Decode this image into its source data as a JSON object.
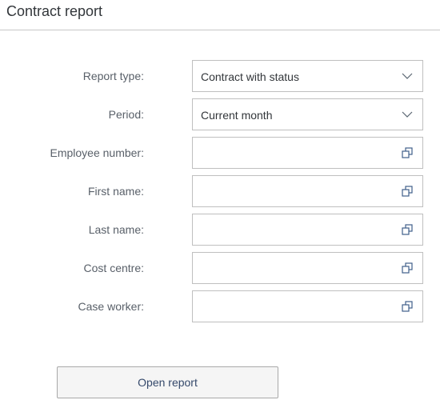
{
  "header": {
    "title": "Contract report"
  },
  "form": {
    "fields": [
      {
        "label": "Report type:",
        "value": "Contract with status",
        "type": "select",
        "icon": "chevron-down-icon"
      },
      {
        "label": "Period:",
        "value": "Current month",
        "type": "select",
        "icon": "chevron-down-icon"
      },
      {
        "label": "Employee number:",
        "value": "",
        "type": "input",
        "icon": "value-help-icon"
      },
      {
        "label": "First name:",
        "value": "",
        "type": "input",
        "icon": "value-help-icon"
      },
      {
        "label": "Last name:",
        "value": "",
        "type": "input",
        "icon": "value-help-icon"
      },
      {
        "label": "Cost centre:",
        "value": "",
        "type": "input",
        "icon": "value-help-icon"
      },
      {
        "label": "Case worker:",
        "value": "",
        "type": "input",
        "icon": "value-help-icon"
      }
    ]
  },
  "actions": {
    "open_report_label": "Open report"
  }
}
